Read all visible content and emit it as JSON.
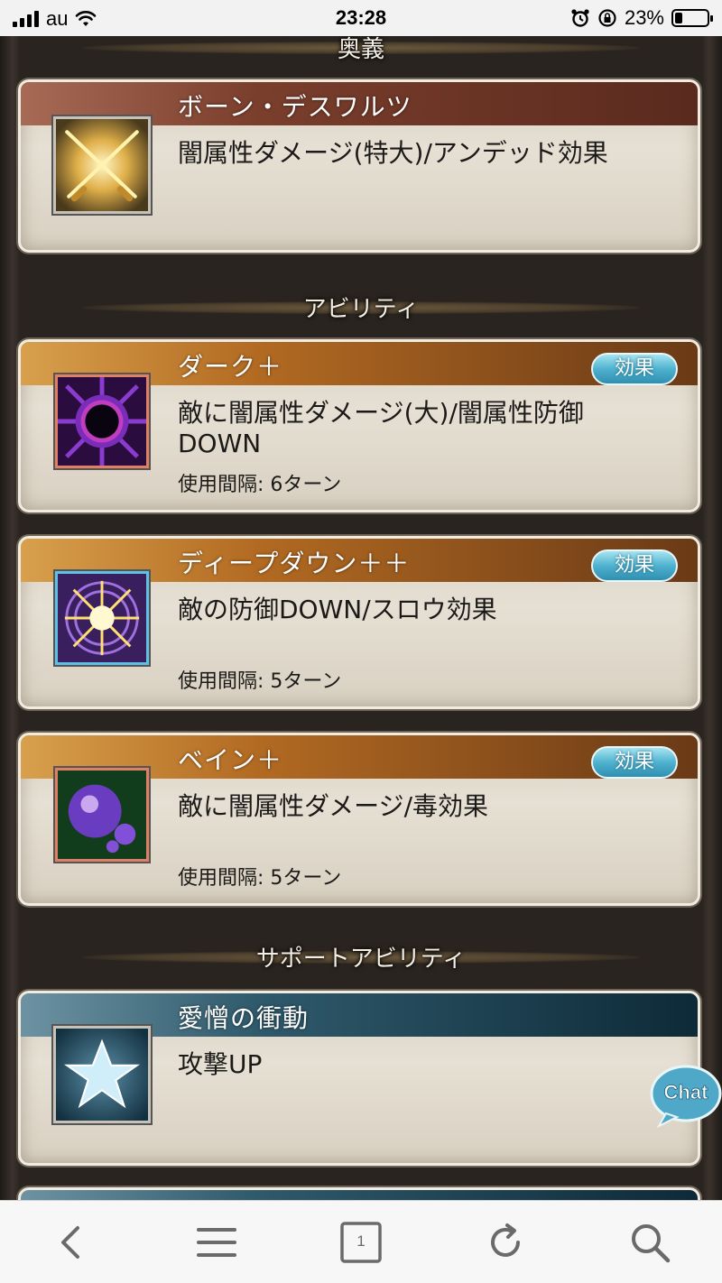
{
  "status_bar": {
    "carrier": "au",
    "time": "23:28",
    "battery_percent": "23%",
    "battery_level": 0.23
  },
  "sections": {
    "ougi": "奥義",
    "ability": "アビリティ",
    "support": "サポートアビリティ"
  },
  "ougi_card": {
    "title": "ボーン・デスワルツ",
    "description": "闇属性ダメージ(特大)/アンデッド効果",
    "icon": "crossed-swords-icon"
  },
  "abilities": [
    {
      "title": "ダーク＋",
      "description": "敵に闇属性ダメージ(大)/闇属性防御DOWN",
      "interval": "使用間隔: 6ターン",
      "effect_label": "効果",
      "icon": "dark-orb-icon"
    },
    {
      "title": "ディープダウン＋＋",
      "description": "敵の防御DOWN/スロウ効果",
      "interval": "使用間隔: 5ターン",
      "effect_label": "効果",
      "icon": "burst-icon"
    },
    {
      "title": "ベイン＋",
      "description": "敵に闇属性ダメージ/毒効果",
      "interval": "使用間隔: 5ターン",
      "effect_label": "効果",
      "icon": "poison-bubble-icon"
    }
  ],
  "support_card": {
    "title": "愛憎の衝動",
    "description": "攻撃UP",
    "icon": "star-icon"
  },
  "chat": {
    "label": "Chat"
  },
  "toolbar": {
    "tab_count": "1",
    "icons": [
      "back-icon",
      "menu-icon",
      "tabs-icon",
      "reload-icon",
      "search-icon"
    ]
  },
  "colors": {
    "band_red": "#7a3e2c",
    "band_orange": "#b26a22",
    "band_teal": "#2f5a6c",
    "effect_button": "#4fb2cf"
  }
}
